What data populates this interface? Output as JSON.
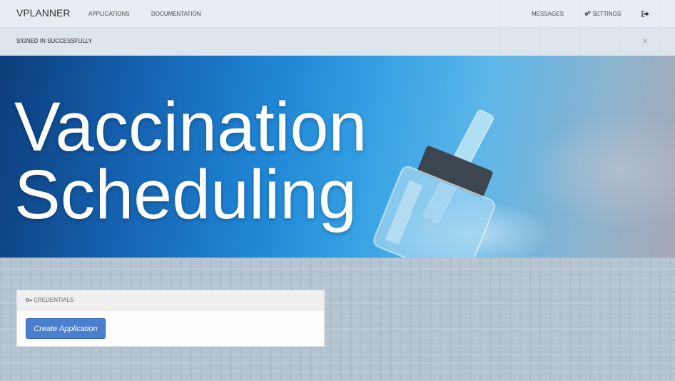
{
  "navbar": {
    "brand": "VPLANNER",
    "links": [
      "APPLICATIONS",
      "DOCUMENTATION"
    ],
    "messages": "MESSAGES",
    "settings": "SETTINGS",
    "settings_icon": "gears-icon",
    "logout_icon": "sign-out-icon"
  },
  "alert": {
    "message": "SIGNED IN SUCCESSFULLY",
    "close": "×"
  },
  "hero": {
    "title_line1": "Vaccination",
    "title_line2": "Scheduling"
  },
  "panel": {
    "heading": "CREDENTIALS",
    "heading_icon": "key-icon",
    "button": "Create Application"
  },
  "colors": {
    "primary_button": "#4a7fd0",
    "navbar_bg": "#ecf0f4",
    "page_bg": "#b4c4d0"
  }
}
